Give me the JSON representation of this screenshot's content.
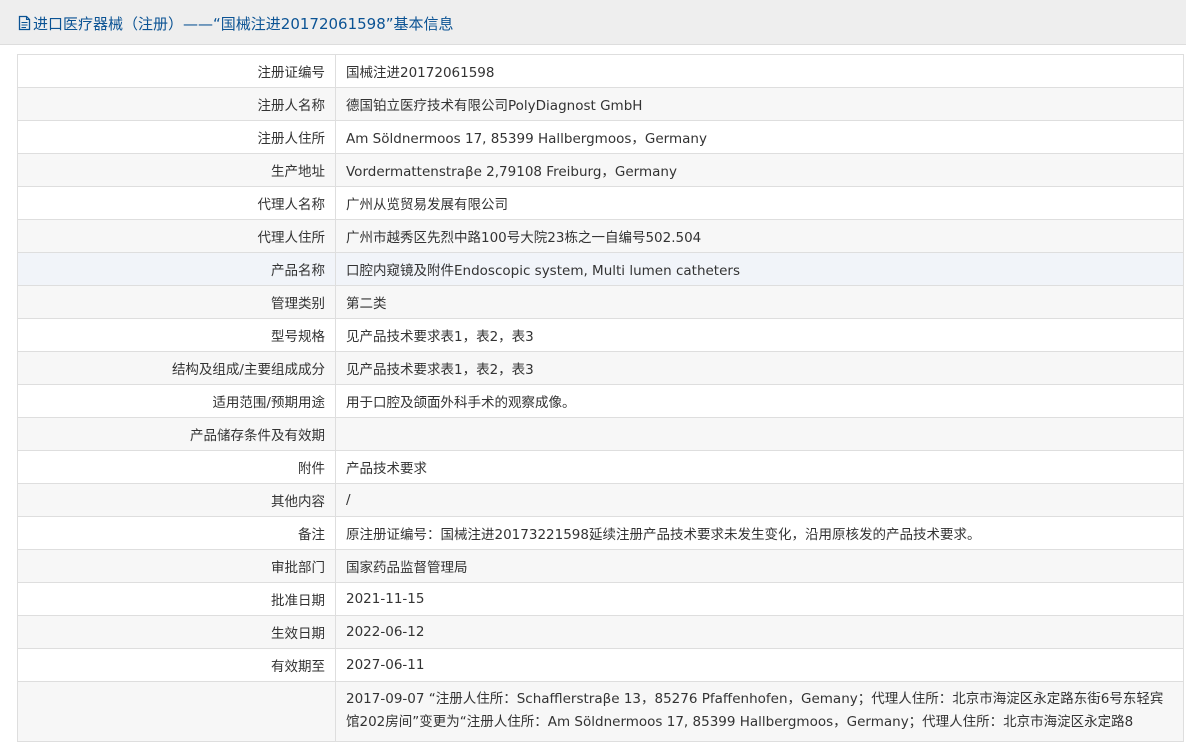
{
  "header": {
    "title": "进口医疗器械（注册）——“国械注进20172061598”基本信息",
    "icon": "document-icon",
    "accent_color": "#0b5394"
  },
  "rows": [
    {
      "label": "注册证编号",
      "value": "国械注进20172061598"
    },
    {
      "label": "注册人名称",
      "value": "德国铂立医疗技术有限公司PolyDiagnost GmbH"
    },
    {
      "label": "注册人住所",
      "value": "Am Söldnermoos 17, 85399 Hallbergmoos，Germany"
    },
    {
      "label": "生产地址",
      "value": "Vordermattenstraβe 2,79108 Freiburg，Germany"
    },
    {
      "label": "代理人名称",
      "value": "广州从览贸易发展有限公司"
    },
    {
      "label": "代理人住所",
      "value": "广州市越秀区先烈中路100号大院23栋之一自编号502.504"
    },
    {
      "label": "产品名称",
      "value": "口腔内窥镜及附件Endoscopic system, Multi lumen catheters"
    },
    {
      "label": "管理类别",
      "value": "第二类"
    },
    {
      "label": "型号规格",
      "value": "见产品技术要求表1，表2，表3"
    },
    {
      "label": "结构及组成/主要组成成分",
      "value": "见产品技术要求表1，表2，表3"
    },
    {
      "label": "适用范围/预期用途",
      "value": "用于口腔及颌面外科手术的观察成像。"
    },
    {
      "label": "产品储存条件及有效期",
      "value": ""
    },
    {
      "label": "附件",
      "value": "产品技术要求"
    },
    {
      "label": "其他内容",
      "value": "/"
    },
    {
      "label": "备注",
      "value": "原注册证编号：国械注进20173221598延续注册产品技术要求未发生变化，沿用原核发的产品技术要求。"
    },
    {
      "label": "审批部门",
      "value": "国家药品监督管理局"
    },
    {
      "label": "批准日期",
      "value": "2021-11-15"
    },
    {
      "label": "生效日期",
      "value": "2022-06-12"
    },
    {
      "label": "有效期至",
      "value": "2027-06-11"
    },
    {
      "label": "",
      "value": "2017-09-07 “注册人住所：Schafflerstraβe 13，85276 Pfaffenhofen，Gemany；代理人住所：北京市海淀区永定路东街6号东轻宾馆202房间”变更为“注册人住所：Am Söldnermoos 17, 85399 Hallbergmoos，Germany；代理人住所：北京市海淀区永定路8"
    }
  ]
}
